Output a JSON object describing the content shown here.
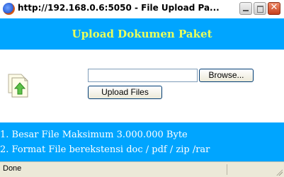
{
  "window": {
    "title": "http://192.168.0.6:5050 - File Upload Pa...",
    "title_icon": "firefox-globe-icon"
  },
  "header": {
    "title": "Upload Dokumen Paket",
    "title_color": "#e9ff5c",
    "band_color": "#00a5ff"
  },
  "form": {
    "file_value": "",
    "browse_label": "Browse...",
    "upload_label": "Upload Files",
    "icon": "document-upload-icon"
  },
  "info": {
    "lines": [
      "1. Besar File Maksimum 3.000.000 Byte",
      "2. Format File berekstensi doc / pdf / zip /rar"
    ]
  },
  "status": {
    "text": "Done"
  }
}
